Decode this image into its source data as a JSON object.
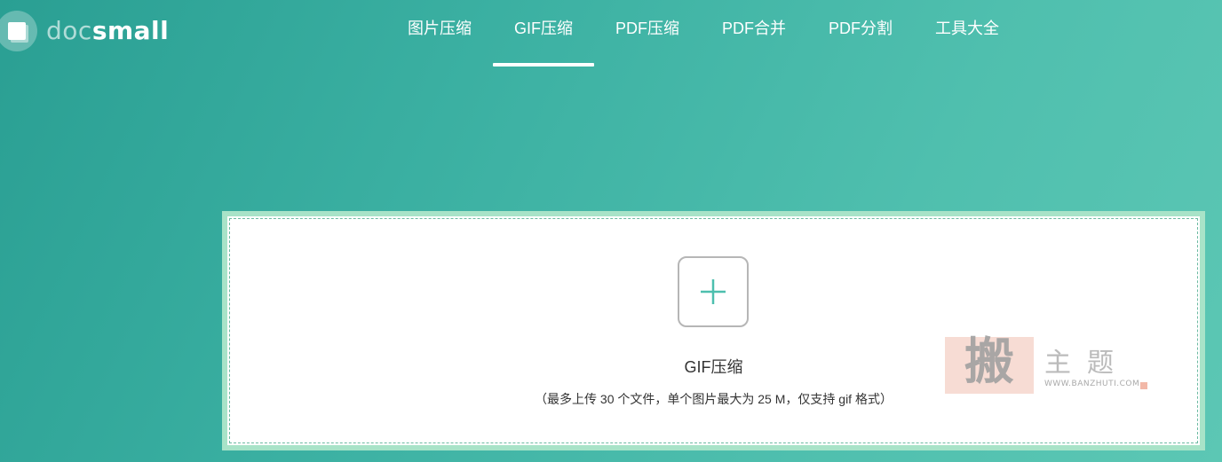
{
  "logo": {
    "text_doc": "doc",
    "text_small": "small",
    "icon": "docsmall-logo-icon"
  },
  "nav": {
    "active_index": 1,
    "items": [
      {
        "label": "图片压缩"
      },
      {
        "label": "GIF压缩"
      },
      {
        "label": "PDF压缩"
      },
      {
        "label": "PDF合并"
      },
      {
        "label": "PDF分割"
      },
      {
        "label": "工具大全"
      }
    ]
  },
  "upload": {
    "add_icon": "plus-icon",
    "title": "GIF压缩",
    "hint": "（最多上传 30 个文件，单个图片最大为 25 M，仅支持 gif 格式）"
  },
  "watermark": {
    "seal_char": "搬",
    "name": "主题",
    "url": "WWW.BANZHUTI.COM"
  },
  "colors": {
    "accent": "#3bb0a2",
    "plus": "#4dbfae",
    "upload_border": "#a8e3c8"
  }
}
